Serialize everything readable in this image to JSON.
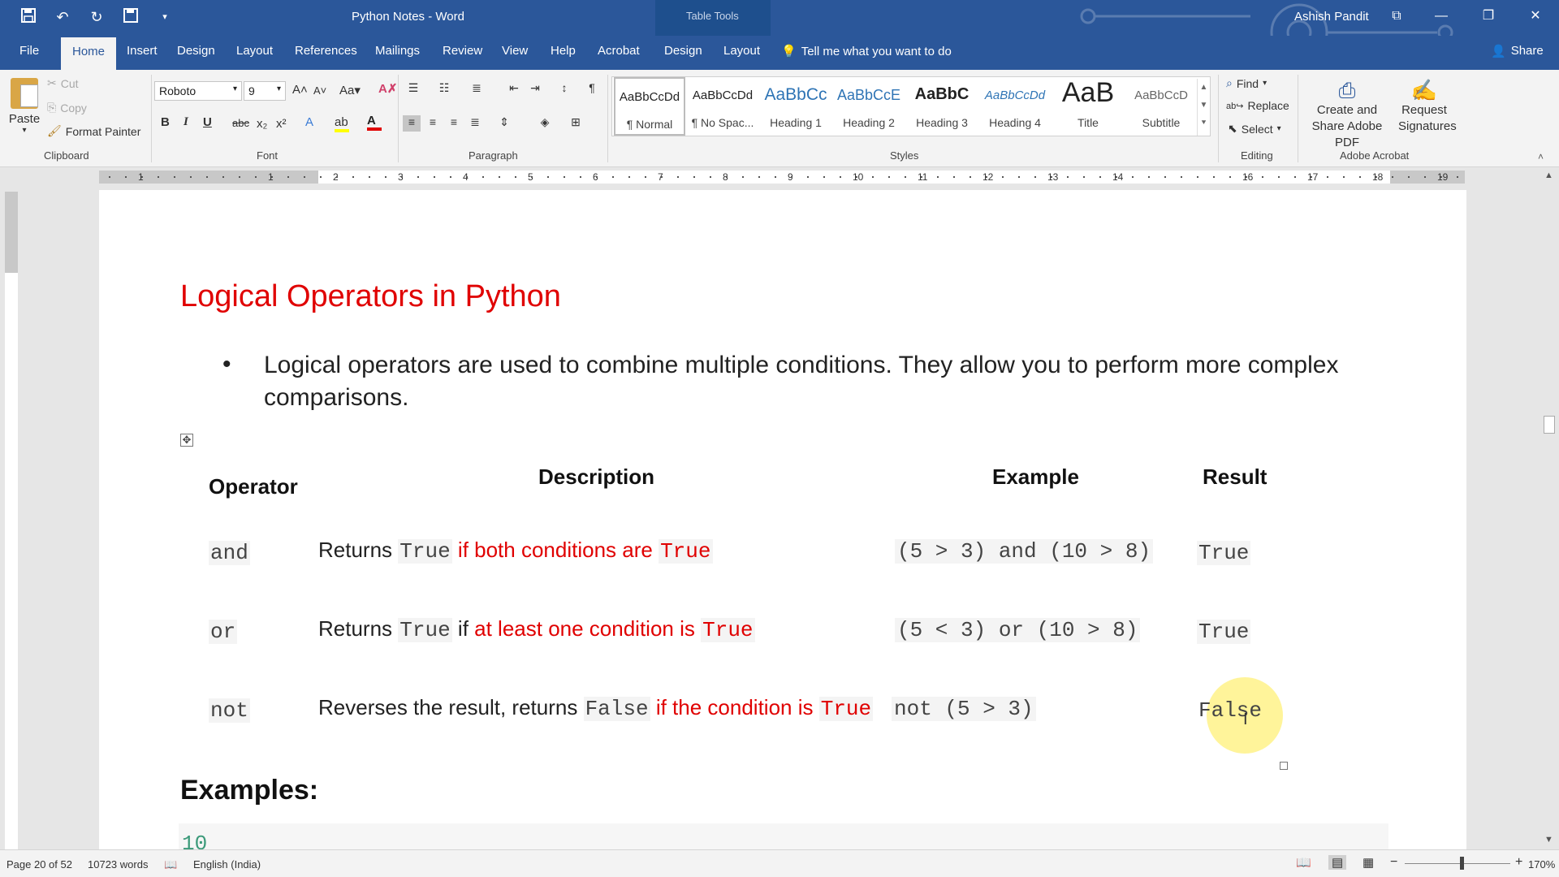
{
  "titlebar": {
    "doc_title": "Python Notes  -  Word",
    "contextual_tab": "Table Tools",
    "user": "Ashish Pandit"
  },
  "tabs": [
    "File",
    "Home",
    "Insert",
    "Design",
    "Layout",
    "References",
    "Mailings",
    "Review",
    "View",
    "Help",
    "Acrobat",
    "Design",
    "Layout"
  ],
  "tell_me": "Tell me what you want to do",
  "share": "Share",
  "ribbon": {
    "clipboard": {
      "paste": "Paste",
      "cut": "Cut",
      "copy": "Copy",
      "format_painter": "Format Painter",
      "label": "Clipboard"
    },
    "font": {
      "name": "Roboto",
      "size": "9",
      "label": "Font"
    },
    "paragraph": {
      "label": "Paragraph"
    },
    "styles": {
      "label": "Styles",
      "items": [
        {
          "preview": "AaBbCcDd",
          "name": "¶ Normal"
        },
        {
          "preview": "AaBbCcDd",
          "name": "¶ No Spac..."
        },
        {
          "preview": "AaBbCc",
          "name": "Heading 1"
        },
        {
          "preview": "AaBbCcE",
          "name": "Heading 2"
        },
        {
          "preview": "AaBbC",
          "name": "Heading 3"
        },
        {
          "preview": "AaBbCcDd",
          "name": "Heading 4"
        },
        {
          "preview": "AaB",
          "name": "Title"
        },
        {
          "preview": "AaBbCcD",
          "name": "Subtitle"
        }
      ]
    },
    "editing": {
      "find": "Find",
      "replace": "Replace",
      "select": "Select",
      "label": "Editing"
    },
    "acrobat": {
      "create_share": "Create and Share Adobe PDF",
      "request_signatures": "Request Signatures",
      "label": "Adobe Acrobat"
    }
  },
  "ruler": {
    "numbers": [
      "1",
      "1",
      "2",
      "3",
      "4",
      "5",
      "6",
      "7",
      "8",
      "9",
      "10",
      "11",
      "12",
      "13",
      "14",
      "16",
      "17",
      "18",
      "19"
    ]
  },
  "document": {
    "heading": "Logical Operators in Python",
    "bullet": "Logical operators are used to combine multiple conditions. They allow you to perform more complex comparisons.",
    "table": {
      "headers": {
        "operator": "Operator",
        "description": "Description",
        "example": "Example",
        "result": "Result"
      },
      "rows": [
        {
          "operator": "and",
          "desc_1": "Returns ",
          "desc_code_1": "True",
          "desc_2": " if both conditions are ",
          "desc_code_2": "True",
          "example": "(5 > 3) and (10 > 8)",
          "result": "True"
        },
        {
          "operator": "or",
          "desc_1": "Returns ",
          "desc_code_1": "True",
          "desc_2a": " if ",
          "desc_2": "at least one condition is ",
          "desc_code_2": "True",
          "example": "(5 < 3) or (10 > 8)",
          "result": "True"
        },
        {
          "operator": "not",
          "desc_1": "Reverses the result, returns ",
          "desc_code_1": "False",
          "desc_2": " if the condition is ",
          "desc_code_2": "True",
          "example": "not (5 > 3)",
          "result": "False"
        }
      ]
    },
    "examples_heading": "Examples:",
    "code_partial": "10"
  },
  "status": {
    "page": "Page 20 of 52",
    "words": "10723 words",
    "language": "English (India)",
    "zoom": "170%"
  },
  "colors": {
    "accent": "#2b579a",
    "heading_red": "#e00000"
  }
}
